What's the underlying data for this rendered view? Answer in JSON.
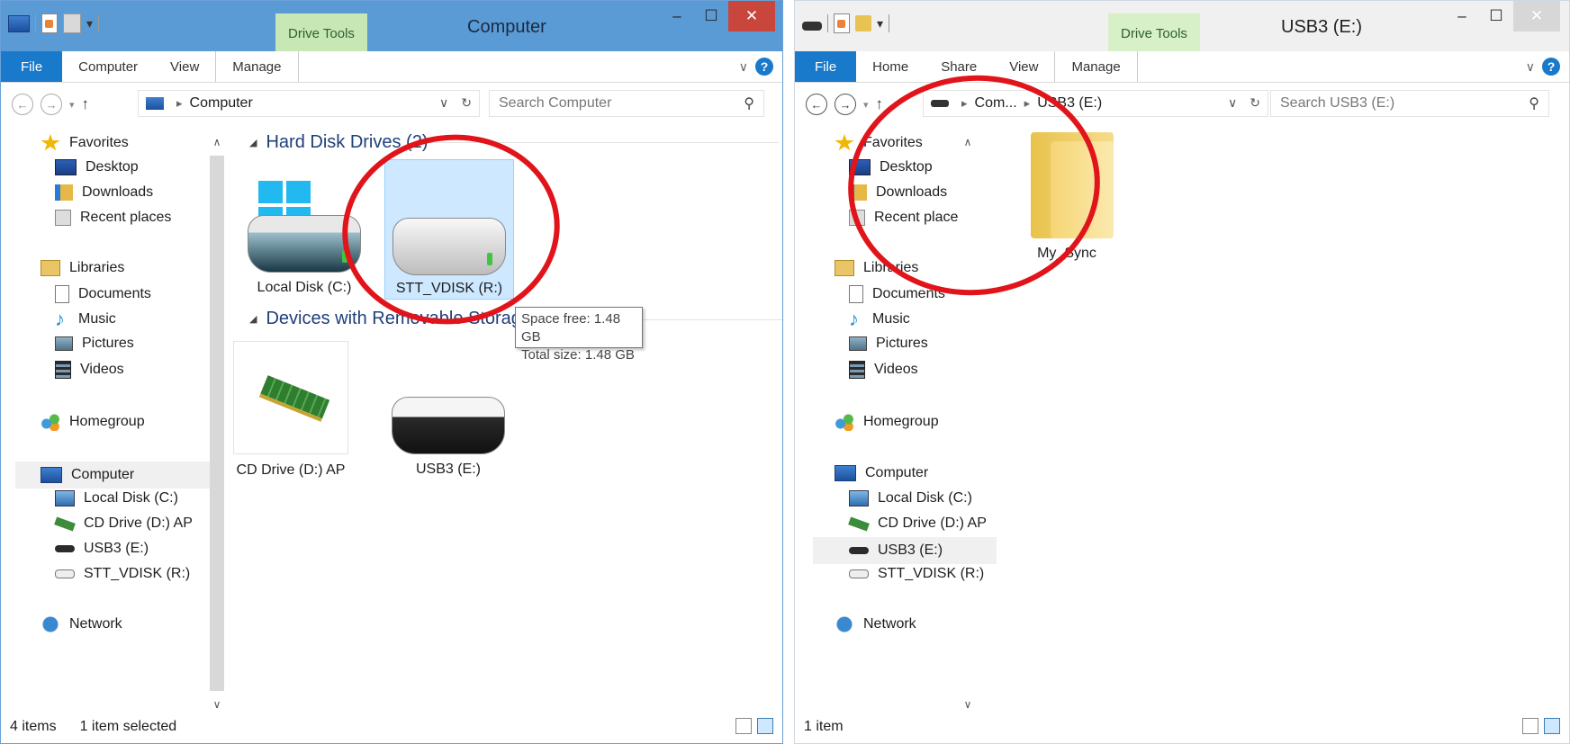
{
  "window_left": {
    "title": "Computer",
    "context_tab": "Drive Tools",
    "ribbon_tabs": [
      "File",
      "Computer",
      "View",
      "Manage"
    ],
    "address": "Computer",
    "search_placeholder": "Search Computer",
    "nav": {
      "favorites": "Favorites",
      "desktop": "Desktop",
      "downloads": "Downloads",
      "recent": "Recent places",
      "libraries": "Libraries",
      "documents": "Documents",
      "music": "Music",
      "pictures": "Pictures",
      "videos": "Videos",
      "homegroup": "Homegroup",
      "computer": "Computer",
      "local_disk": "Local Disk (C:)",
      "cd_drive": "CD Drive (D:) AP",
      "usb3": "USB3 (E:)",
      "vdisk": "STT_VDISK (R:)",
      "network": "Network"
    },
    "groups": {
      "hdd": "Hard Disk Drives (2)",
      "removable": "Devices with Removable Storage ("
    },
    "items": {
      "local_disk": "Local Disk (C:)",
      "vdisk": "STT_VDISK (R:)",
      "cd_drive": "CD Drive (D:) AP",
      "usb3": "USB3 (E:)"
    },
    "tooltip": {
      "free": "Space free: 1.48 GB",
      "total": "Total size: 1.48 GB"
    },
    "status": {
      "count": "4 items",
      "selected": "1 item selected"
    }
  },
  "window_right": {
    "title": "USB3 (E:)",
    "context_tab": "Drive Tools",
    "ribbon_tabs": [
      "File",
      "Home",
      "Share",
      "View",
      "Manage"
    ],
    "address_parent": "Com...",
    "address_current": "USB3 (E:)",
    "search_placeholder": "Search USB3 (E:)",
    "nav": {
      "favorites": "Favorites",
      "desktop": "Desktop",
      "downloads": "Downloads",
      "recent": "Recent place",
      "libraries": "Libraries",
      "documents": "Documents",
      "music": "Music",
      "pictures": "Pictures",
      "videos": "Videos",
      "homegroup": "Homegroup",
      "computer": "Computer",
      "local_disk": "Local Disk (C:)",
      "cd_drive": "CD Drive (D:) AP",
      "usb3": "USB3 (E:)",
      "vdisk": "STT_VDISK (R:)",
      "network": "Network"
    },
    "folder": "My_Sync",
    "status": {
      "count": "1 item"
    }
  },
  "colors": {
    "titlebar_active": "#5b9bd5",
    "file_tab": "#1979ca",
    "context_tab": "#c7e8b4",
    "selection": "#cde8ff",
    "annotation_circle": "#e0141a"
  }
}
